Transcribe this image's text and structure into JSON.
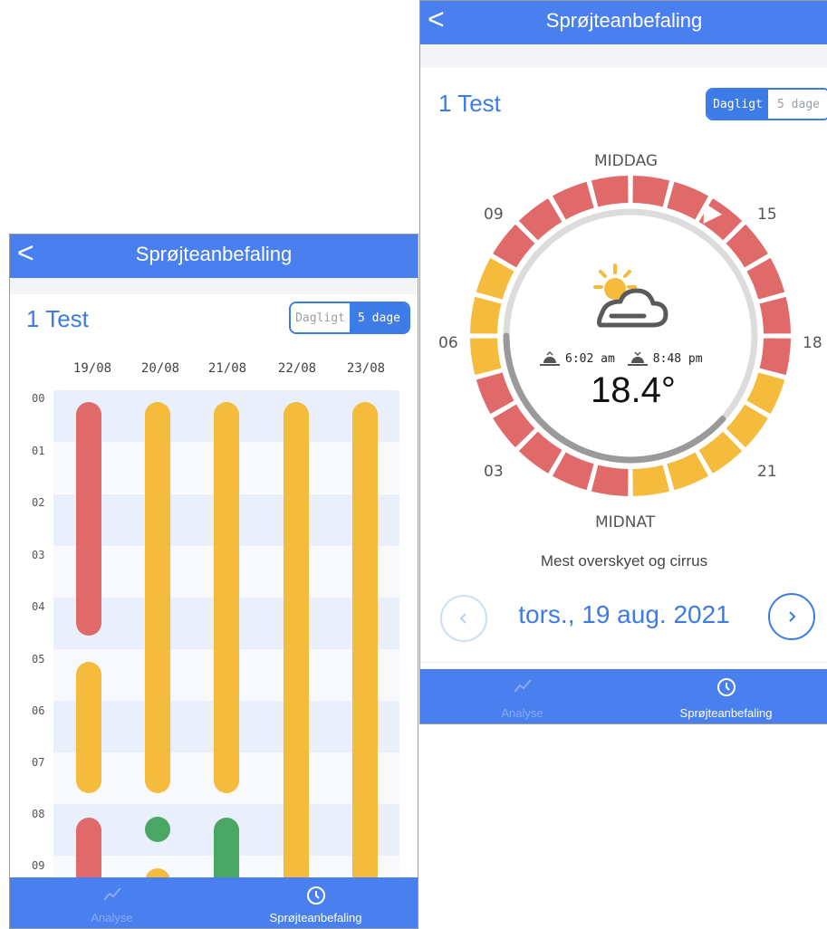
{
  "five_day": {
    "header": {
      "back_glyph": "<",
      "title": "Sprøjteanbefaling"
    },
    "page_title": "1 Test",
    "toggle": {
      "daily": "Dagligt",
      "five_day": "5 dage",
      "selected": "5 dage"
    },
    "dates": [
      "19/08",
      "20/08",
      "21/08",
      "22/08",
      "23/08"
    ],
    "hours": [
      "00",
      "01",
      "02",
      "03",
      "04",
      "05",
      "06",
      "07",
      "08",
      "09"
    ],
    "status_colors": {
      "red": "#e06a6a",
      "yellow": "#f4bb3d",
      "green": "#4aa664"
    },
    "tabbar": {
      "analyse": "Analyse",
      "spray": "Sprøjteanbefaling"
    }
  },
  "daily": {
    "header": {
      "back_glyph": "<",
      "title": "Sprøjteanbefaling"
    },
    "page_title": "1 Test",
    "toggle": {
      "daily": "Dagligt",
      "five_day": "5 dage",
      "selected": "Dagligt"
    },
    "clock": {
      "top": "MIDDAG",
      "bottom": "MIDNAT",
      "h09": "09",
      "h15": "15",
      "h06": "06",
      "h18": "18",
      "h03": "03",
      "h21": "21"
    },
    "weather": {
      "icon": "partly-cloudy-icon",
      "sunrise": "6:02 am",
      "sunset": "8:48 pm",
      "temperature": "18.4°",
      "description": "Mest overskyet og cirrus"
    },
    "date": "tors., 19 aug. 2021",
    "tabbar": {
      "analyse": "Analyse",
      "spray": "Sprøjteanbefaling"
    }
  }
}
